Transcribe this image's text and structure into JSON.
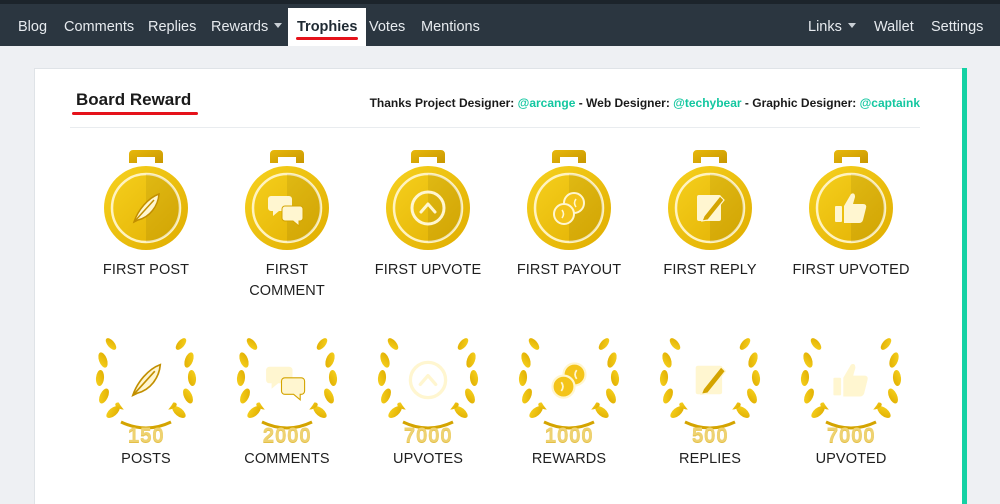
{
  "nav": {
    "left": [
      {
        "label": "Blog",
        "dropdown": false
      },
      {
        "label": "Comments",
        "dropdown": false
      },
      {
        "label": "Replies",
        "dropdown": false
      },
      {
        "label": "Rewards",
        "dropdown": true
      },
      {
        "label": "Trophies",
        "dropdown": false,
        "active": true
      },
      {
        "label": "Votes",
        "dropdown": false
      },
      {
        "label": "Mentions",
        "dropdown": false
      }
    ],
    "right": [
      {
        "label": "Links",
        "dropdown": true
      },
      {
        "label": "Wallet",
        "dropdown": false
      },
      {
        "label": "Settings",
        "dropdown": false
      }
    ]
  },
  "board": {
    "title": "Board Reward",
    "credits": {
      "t1": "Thanks Project Designer: ",
      "u1": "@arcange",
      "t2": " - Web Designer: ",
      "u2": "@techybear",
      "t3": " - Graphic Designer: ",
      "u3": "@captaink"
    }
  },
  "trophies_first": [
    {
      "label": "FIRST POST",
      "icon": "quill-icon"
    },
    {
      "label": "FIRST COMMENT",
      "icon": "speech-bubbles-icon"
    },
    {
      "label": "FIRST UPVOTE",
      "icon": "upvote-chevron-icon"
    },
    {
      "label": "FIRST PAYOUT",
      "icon": "coins-icon"
    },
    {
      "label": "FIRST REPLY",
      "icon": "pencil-note-icon"
    },
    {
      "label": "FIRST UPVOTED",
      "icon": "thumbs-up-icon"
    }
  ],
  "trophies_milestone": [
    {
      "count": "150",
      "label": "POSTS",
      "icon": "quill-icon"
    },
    {
      "count": "2000",
      "label": "COMMENTS",
      "icon": "speech-bubbles-icon"
    },
    {
      "count": "7000",
      "label": "UPVOTES",
      "icon": "upvote-chevron-icon"
    },
    {
      "count": "1000",
      "label": "REWARDS",
      "icon": "coins-icon"
    },
    {
      "count": "500",
      "label": "REPLIES",
      "icon": "pencil-note-icon"
    },
    {
      "count": "7000",
      "label": "UPVOTED",
      "icon": "thumbs-up-icon"
    }
  ],
  "colors": {
    "nav_bg": "#2b3640",
    "accent_red": "#e5121a",
    "accent_teal": "#14d2a4",
    "gold": "#f1c40f",
    "gold_dark": "#d4a400"
  }
}
